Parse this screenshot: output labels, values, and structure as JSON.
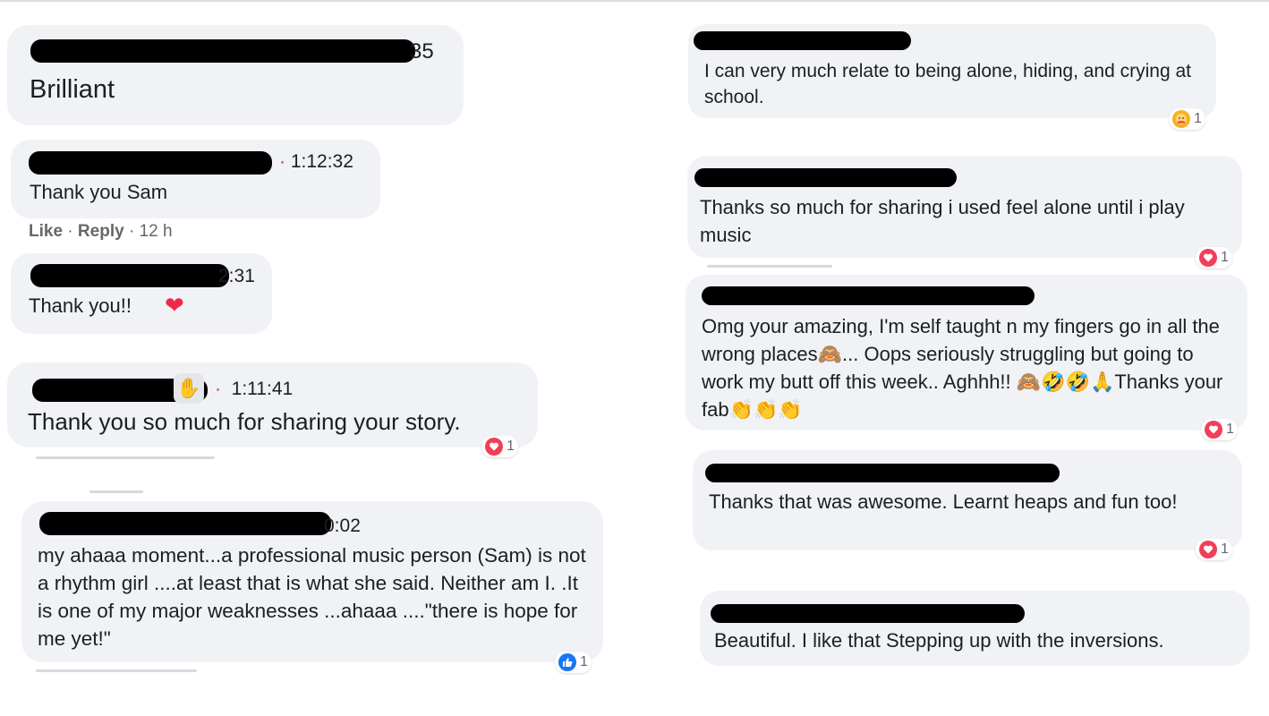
{
  "comments": {
    "c1": {
      "time": "35",
      "text": "Brilliant"
    },
    "c2": {
      "time": "1:12:32",
      "text": "Thank you Sam",
      "actions": {
        "like": "Like",
        "reply": "Reply",
        "age": "12 h"
      }
    },
    "c3": {
      "time": "2:31",
      "text": "Thank you!!",
      "emoji": "❤"
    },
    "c4": {
      "time": "1:11:41",
      "text": "Thank you so much for sharing your story.",
      "reaction_count": "1"
    },
    "c5": {
      "time": "0:02",
      "text": "my ahaaa moment...a professional music person (Sam) is not a rhythm girl ....at least that is what she said. Neither am I. .It is one of my major weaknesses ...ahaaa ....\"there is hope for me yet!\"",
      "reaction_count": "1"
    },
    "c6": {
      "text": "I can very much relate to being alone, hiding, and crying at school.",
      "reaction_count": "1"
    },
    "c7": {
      "text": "Thanks so much for sharing i used feel alone until i play music",
      "reaction_count": "1"
    },
    "c8": {
      "text": "Omg your amazing, I'm self taught n my fingers go in all the wrong places🙈... Oops seriously struggling but going to work my butt off this week.. Aghhh!! 🙈🤣🤣🙏Thanks your fab👏👏👏",
      "reaction_count": "1"
    },
    "c9": {
      "text": "Thanks that was awesome. Learnt heaps and fun too!",
      "reaction_count": "1"
    },
    "c10": {
      "text": "Beautiful. I like that Stepping up with the inversions."
    }
  },
  "icons": {
    "heart": "heart-reaction-icon",
    "like": "like-reaction-icon",
    "care": "care-reaction-icon"
  },
  "colors": {
    "bubble": "#f0f2f5",
    "heart": "#f33e58",
    "like": "#1877f2",
    "timestamp_dot": "#e0245e"
  }
}
